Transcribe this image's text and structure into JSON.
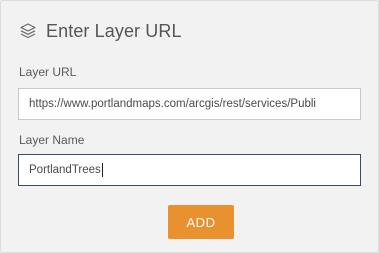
{
  "header": {
    "icon": "layers-icon",
    "title": "Enter Layer URL"
  },
  "layer_url": {
    "label": "Layer URL",
    "value": "https://www.portlandmaps.com/arcgis/rest/services/Publi"
  },
  "layer_name": {
    "label": "Layer Name",
    "value": "PortlandTrees"
  },
  "add_button": {
    "label": "ADD",
    "color": "#e8912e"
  }
}
